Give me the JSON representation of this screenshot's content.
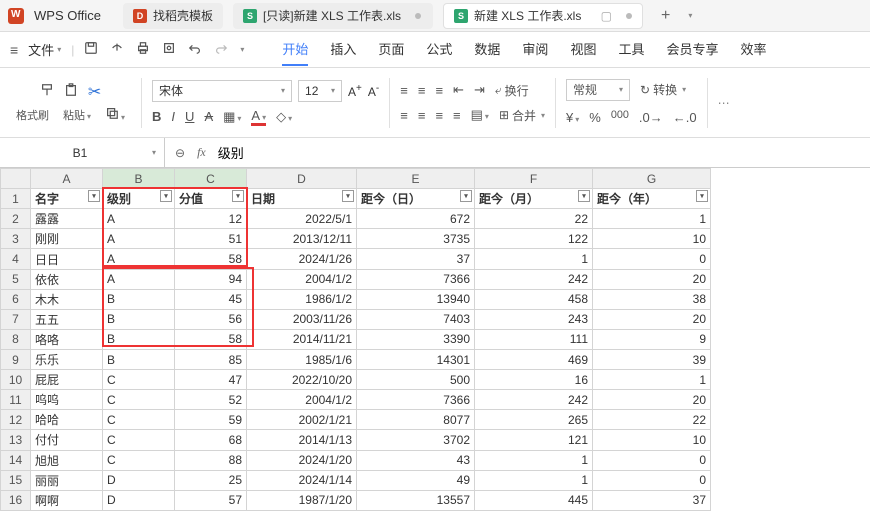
{
  "app": {
    "name": "WPS Office"
  },
  "tabs": [
    {
      "label": "找稻壳模板",
      "icon": "d"
    },
    {
      "label": "[只读]新建 XLS 工作表.xls",
      "icon": "s"
    },
    {
      "label": "新建 XLS 工作表.xls",
      "icon": "s"
    }
  ],
  "menu": {
    "file": "文件",
    "items": [
      "开始",
      "插入",
      "页面",
      "公式",
      "数据",
      "审阅",
      "视图",
      "工具",
      "会员专享",
      "效率"
    ],
    "active": "开始"
  },
  "ribbon": {
    "format_painter": "格式刷",
    "paste": "粘贴",
    "font_name": "宋体",
    "font_size": "12",
    "wrap": "换行",
    "merge": "合并",
    "numfmt": "常规",
    "convert": "转换"
  },
  "namebox": "B1",
  "formula": "级别",
  "columns": [
    "A",
    "B",
    "C",
    "D",
    "E",
    "F",
    "G"
  ],
  "headers": {
    "A": "名字",
    "B": "级别",
    "C": "分值",
    "D": "日期",
    "E": "距今（日）",
    "F": "距今（月）",
    "G": "距今（年）"
  },
  "rows": [
    {
      "n": 2,
      "A": "露露",
      "B": "A",
      "C": 12,
      "D": "2022/5/1",
      "E": 672,
      "F": 22,
      "G": 1
    },
    {
      "n": 3,
      "A": "刚刚",
      "B": "A",
      "C": 51,
      "D": "2013/12/11",
      "E": 3735,
      "F": 122,
      "G": 10
    },
    {
      "n": 4,
      "A": "日日",
      "B": "A",
      "C": 58,
      "D": "2024/1/26",
      "E": 37,
      "F": 1,
      "G": 0
    },
    {
      "n": 5,
      "A": "依依",
      "B": "A",
      "C": 94,
      "D": "2004/1/2",
      "E": 7366,
      "F": 242,
      "G": 20
    },
    {
      "n": 6,
      "A": "木木",
      "B": "B",
      "C": 45,
      "D": "1986/1/2",
      "E": 13940,
      "F": 458,
      "G": 38
    },
    {
      "n": 7,
      "A": "五五",
      "B": "B",
      "C": 56,
      "D": "2003/11/26",
      "E": 7403,
      "F": 243,
      "G": 20
    },
    {
      "n": 8,
      "A": "咯咯",
      "B": "B",
      "C": 58,
      "D": "2014/11/21",
      "E": 3390,
      "F": 111,
      "G": 9
    },
    {
      "n": 9,
      "A": "乐乐",
      "B": "B",
      "C": 85,
      "D": "1985/1/6",
      "E": 14301,
      "F": 469,
      "G": 39
    },
    {
      "n": 10,
      "A": "屁屁",
      "B": "C",
      "C": 47,
      "D": "2022/10/20",
      "E": 500,
      "F": 16,
      "G": 1
    },
    {
      "n": 11,
      "A": "呜呜",
      "B": "C",
      "C": 52,
      "D": "2004/1/2",
      "E": 7366,
      "F": 242,
      "G": 20
    },
    {
      "n": 12,
      "A": "哈哈",
      "B": "C",
      "C": 59,
      "D": "2002/1/21",
      "E": 8077,
      "F": 265,
      "G": 22
    },
    {
      "n": 13,
      "A": "付付",
      "B": "C",
      "C": 68,
      "D": "2014/1/13",
      "E": 3702,
      "F": 121,
      "G": 10
    },
    {
      "n": 14,
      "A": "旭旭",
      "B": "C",
      "C": 88,
      "D": "2024/1/20",
      "E": 43,
      "F": 1,
      "G": 0
    },
    {
      "n": 15,
      "A": "丽丽",
      "B": "D",
      "C": 25,
      "D": "2024/1/14",
      "E": 49,
      "F": 1,
      "G": 0
    },
    {
      "n": 16,
      "A": "啊啊",
      "B": "D",
      "C": 57,
      "D": "1987/1/20",
      "E": 13557,
      "F": 445,
      "G": 37
    }
  ]
}
